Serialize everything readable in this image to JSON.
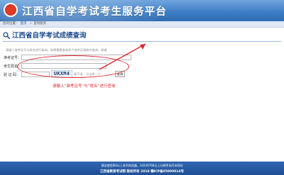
{
  "header": {
    "site_title": "江西省自学考试考生服务平台",
    "colors": {
      "banner": "#3f7dc4",
      "footer": "#2359a3",
      "annotation": "#e0262d",
      "title": "#1f4d8f"
    }
  },
  "nav": {
    "location_label": "您的位置：",
    "home": "首页",
    "separator": ">",
    "current": "查询服务"
  },
  "page": {
    "icon": "search-icon",
    "title": "江西省自学考试成绩查询"
  },
  "form": {
    "notice": "请输入准考证号与姓名进行查询，如果需要查询多个准考证请依次查询，谢谢",
    "exam_id_label": "准考证号：",
    "name_label": "考生姓名：",
    "captcha_label": "验 证 码：",
    "captcha_code": "UKXM4",
    "captcha_hint": "看不清，点击换一个",
    "submit_label": "查询"
  },
  "annotation": {
    "text": "请输入“准考证号”与“姓名”进行查询"
  },
  "footer": {
    "line1": "建议使用IE8以上系列浏览器，1024X768以上分辨率访问本网站",
    "line2": "江西省教育考试院 版权所有 2018 赣ICP备05000014号"
  }
}
